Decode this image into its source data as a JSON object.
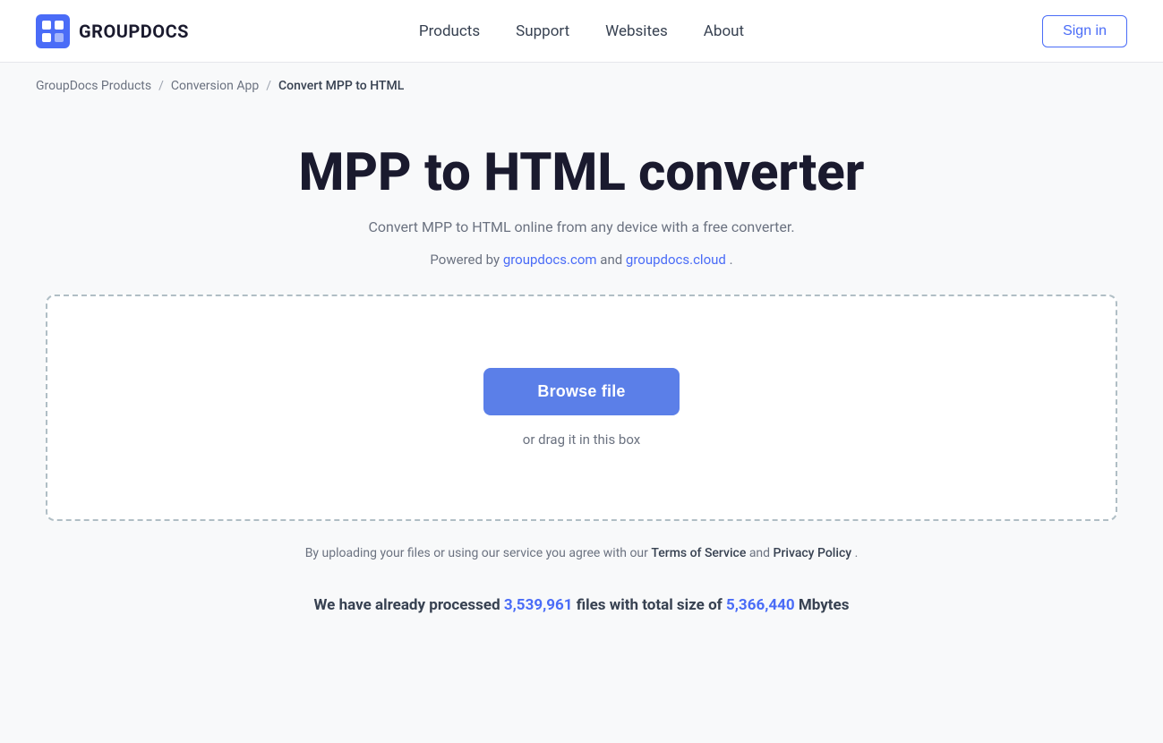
{
  "header": {
    "logo_text": "GROUPDOCS",
    "nav_items": [
      {
        "label": "Products",
        "id": "products"
      },
      {
        "label": "Support",
        "id": "support"
      },
      {
        "label": "Websites",
        "id": "websites"
      },
      {
        "label": "About",
        "id": "about"
      }
    ],
    "sign_in_label": "Sign in"
  },
  "breadcrumb": {
    "items": [
      {
        "label": "GroupDocs Products",
        "id": "groupdocs-products"
      },
      {
        "label": "Conversion App",
        "id": "conversion-app"
      },
      {
        "label": "Convert MPP to HTML",
        "id": "current",
        "current": true
      }
    ]
  },
  "main": {
    "title": "MPP to HTML converter",
    "subtitle": "Convert MPP to HTML online from any device with a free converter.",
    "powered_by_prefix": "Powered by ",
    "powered_by_link1_text": "groupdocs.com",
    "powered_by_link1_url": "https://groupdocs.com",
    "powered_by_middle": " and ",
    "powered_by_link2_text": "groupdocs.cloud",
    "powered_by_link2_url": "https://groupdocs.cloud",
    "powered_by_suffix": ".",
    "drop_zone": {
      "browse_button_label": "Browse file",
      "drag_text": "or drag it in this box"
    },
    "terms_prefix": "By uploading your files or using our service you agree with our ",
    "terms_link1": "Terms of Service",
    "terms_middle": " and ",
    "terms_link2": "Privacy Policy",
    "terms_suffix": ".",
    "stats_prefix": "We have already processed ",
    "stats_files_count": "3,539,961",
    "stats_middle": " files with total size of ",
    "stats_size": "5,366,440",
    "stats_suffix": " Mbytes"
  }
}
